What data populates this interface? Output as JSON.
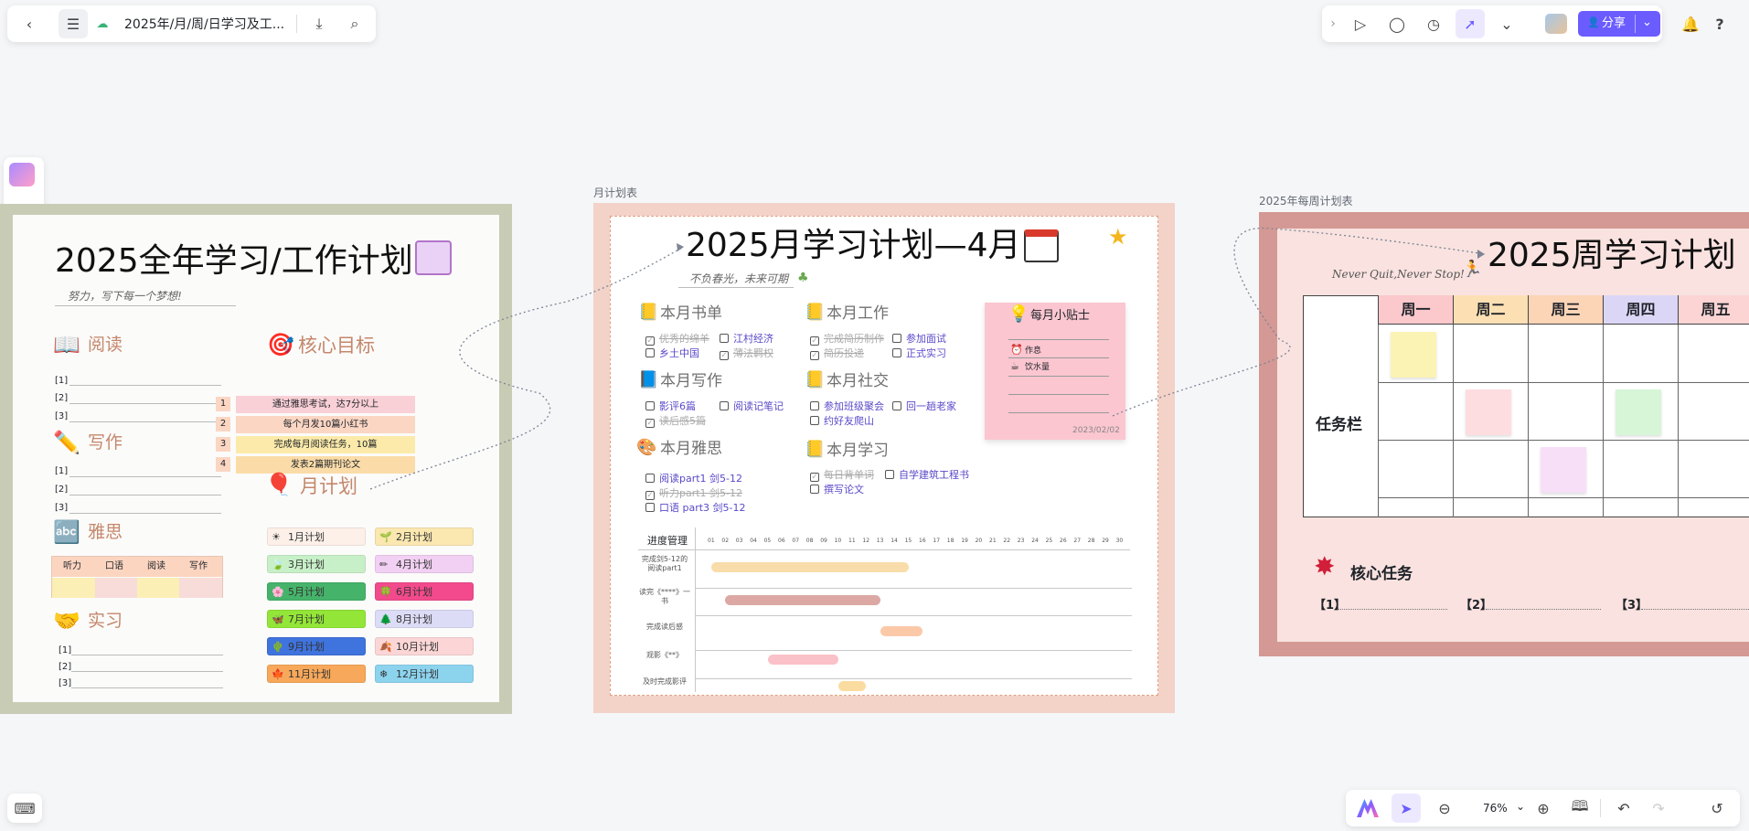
{
  "topbar": {
    "doc_title": "2025年/月/周/日学习及工..."
  },
  "share_label": "分享",
  "zoom": "76%",
  "labels": {
    "month": "月计划表",
    "week": "2025年每周计划表"
  },
  "year": {
    "title": "2025全年学习/工作计划",
    "subtitle": "努力，写下每一个梦想!",
    "reading": "阅读",
    "writing": "写作",
    "yasi": "雅思",
    "intern": "实习",
    "core": "核心目标",
    "monthplan": "月计划",
    "n1": "[1]",
    "n2": "[2]",
    "n3": "[3]",
    "skills": [
      "听力",
      "口语",
      "阅读",
      "写作"
    ],
    "goals": [
      {
        "no": "1",
        "text": "通过雅思考试，达7分以上"
      },
      {
        "no": "2",
        "text": "每个月发10篇小红书"
      },
      {
        "no": "3",
        "text": "完成每月阅读任务，10篇"
      },
      {
        "no": "4",
        "text": "发表2篇期刊论文"
      }
    ],
    "months": [
      "1月计划",
      "2月计划",
      "3月计划",
      "4月计划",
      "5月计划",
      "6月计划",
      "7月计划",
      "8月计划",
      "9月计划",
      "10月计划",
      "11月计划",
      "12月计划"
    ]
  },
  "month": {
    "title": "2025月学习计划—4月",
    "subtitle": "不负春光，未来可期",
    "books": "本月书单",
    "work": "本月工作",
    "write": "本月写作",
    "social": "本月社交",
    "yasi": "本月雅思",
    "study": "本月学习",
    "b1": "优秀的绵羊",
    "b2": "江村经济",
    "b3": "乡土中国",
    "b4": "薄法羁权",
    "w1": "完成简历制作",
    "w2": "参加面试",
    "w3": "简历投递",
    "w4": "正式实习",
    "wr1": "影评6篇",
    "wr2": "阅读记笔记",
    "wr3": "读后感5篇",
    "s1": "参加班级聚会",
    "s2": "回一趟老家",
    "s3": "约好友爬山",
    "y1": "阅读part1 剑5-12",
    "y2": "听力part1 剑5-12",
    "y3": "口语 part3 剑5-12",
    "st1": "每日背单词",
    "st2": "自学建筑工程书",
    "st3": "撰写论文",
    "sticky_title": "每月小贴士",
    "sticky_a": "作息",
    "sticky_b": "饮水量",
    "sticky_date": "2023/02/02",
    "progress": "进度管理",
    "days": [
      "01",
      "02",
      "03",
      "04",
      "05",
      "06",
      "07",
      "08",
      "09",
      "10",
      "11",
      "12",
      "13",
      "14",
      "15",
      "16",
      "17",
      "18",
      "19",
      "20",
      "21",
      "22",
      "23",
      "24",
      "25",
      "26",
      "27",
      "28",
      "29",
      "30"
    ],
    "rows": [
      "完成剑5-12的阅读part1",
      "读完《****》一书",
      "完成读后感",
      "观影《**》",
      "及时完成影评"
    ]
  },
  "week": {
    "title": "2025周学习计划",
    "motto": "Never Quit,Never Stop!",
    "days": [
      "周一",
      "周二",
      "周三",
      "周四",
      "周五"
    ],
    "row_label": "任务栏",
    "core": "核心任务",
    "n1": "【1】",
    "n2": "【2】",
    "n3": "【3】"
  },
  "colors": {
    "accent": "#6b5cff",
    "year_border": "#c9ccb5",
    "month_bg": "#f3d2c8",
    "week_border": "#d49994"
  }
}
